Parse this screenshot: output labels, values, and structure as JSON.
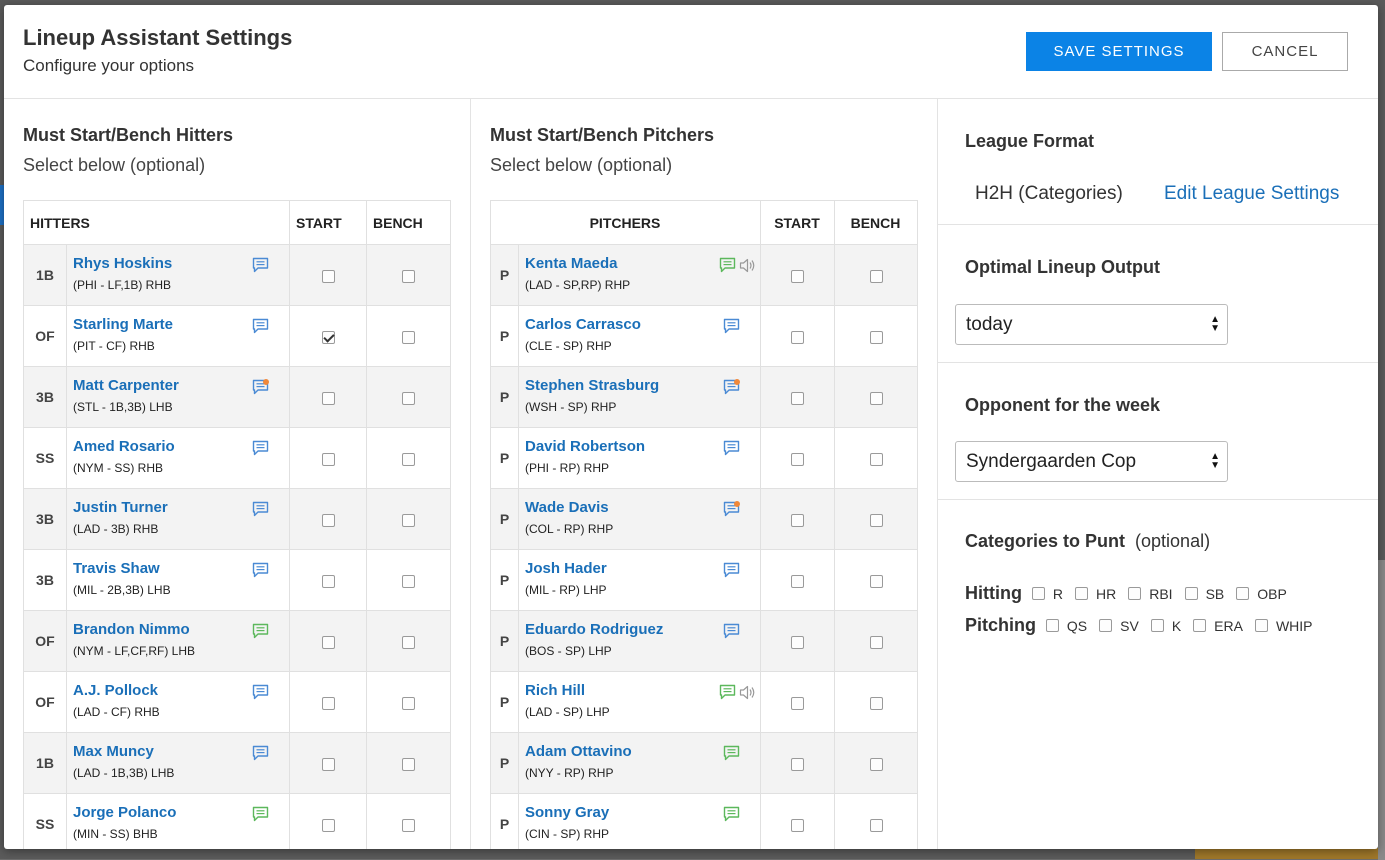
{
  "header": {
    "title": "Lineup Assistant Settings",
    "subtitle": "Configure your options",
    "save_label": "SAVE SETTINGS",
    "cancel_label": "CANCEL"
  },
  "hitters_section": {
    "title": "Must Start/Bench Hitters",
    "subtitle": "Select below (optional)",
    "columns": [
      "HITTERS",
      "START",
      "BENCH"
    ],
    "rows": [
      {
        "pos": "1B",
        "name": "Rhys Hoskins",
        "info": "(PHI - LF,1B) RHB",
        "note": "blue",
        "start": false,
        "bench": false
      },
      {
        "pos": "OF",
        "name": "Starling Marte",
        "info": "(PIT - CF) RHB",
        "note": "blue",
        "start": true,
        "bench": false
      },
      {
        "pos": "3B",
        "name": "Matt Carpenter",
        "info": "(STL - 1B,3B) LHB",
        "note": "orange",
        "start": false,
        "bench": false
      },
      {
        "pos": "SS",
        "name": "Amed Rosario",
        "info": "(NYM - SS) RHB",
        "note": "blue",
        "start": false,
        "bench": false
      },
      {
        "pos": "3B",
        "name": "Justin Turner",
        "info": "(LAD - 3B) RHB",
        "note": "blue",
        "start": false,
        "bench": false
      },
      {
        "pos": "3B",
        "name": "Travis Shaw",
        "info": "(MIL - 2B,3B) LHB",
        "note": "blue",
        "start": false,
        "bench": false
      },
      {
        "pos": "OF",
        "name": "Brandon Nimmo",
        "info": "(NYM - LF,CF,RF) LHB",
        "note": "green",
        "start": false,
        "bench": false
      },
      {
        "pos": "OF",
        "name": "A.J. Pollock",
        "info": "(LAD - CF) RHB",
        "note": "blue",
        "start": false,
        "bench": false
      },
      {
        "pos": "1B",
        "name": "Max Muncy",
        "info": "(LAD - 1B,3B) LHB",
        "note": "blue",
        "start": false,
        "bench": false
      },
      {
        "pos": "SS",
        "name": "Jorge Polanco",
        "info": "(MIN - SS) BHB",
        "note": "green",
        "start": false,
        "bench": false
      }
    ]
  },
  "pitchers_section": {
    "title": "Must Start/Bench Pitchers",
    "subtitle": "Select below (optional)",
    "columns": [
      "PITCHERS",
      "START",
      "BENCH"
    ],
    "rows": [
      {
        "pos": "P",
        "name": "Kenta Maeda",
        "info": "(LAD - SP,RP) RHP",
        "note": "green",
        "sound": true,
        "start": false,
        "bench": false
      },
      {
        "pos": "P",
        "name": "Carlos Carrasco",
        "info": "(CLE - SP) RHP",
        "note": "blue",
        "sound": false,
        "start": false,
        "bench": false
      },
      {
        "pos": "P",
        "name": "Stephen Strasburg",
        "info": "(WSH - SP) RHP",
        "note": "orange",
        "sound": false,
        "start": false,
        "bench": false
      },
      {
        "pos": "P",
        "name": "David Robertson",
        "info": "(PHI - RP) RHP",
        "note": "blue",
        "sound": false,
        "start": false,
        "bench": false
      },
      {
        "pos": "P",
        "name": "Wade Davis",
        "info": "(COL - RP) RHP",
        "note": "orange",
        "sound": false,
        "start": false,
        "bench": false
      },
      {
        "pos": "P",
        "name": "Josh Hader",
        "info": "(MIL - RP) LHP",
        "note": "blue",
        "sound": false,
        "start": false,
        "bench": false
      },
      {
        "pos": "P",
        "name": "Eduardo Rodriguez",
        "info": "(BOS - SP) LHP",
        "note": "blue",
        "sound": false,
        "start": false,
        "bench": false
      },
      {
        "pos": "P",
        "name": "Rich Hill",
        "info": "(LAD - SP) LHP",
        "note": "green",
        "sound": true,
        "start": false,
        "bench": false
      },
      {
        "pos": "P",
        "name": "Adam Ottavino",
        "info": "(NYY - RP) RHP",
        "note": "green",
        "sound": false,
        "start": false,
        "bench": false
      },
      {
        "pos": "P",
        "name": "Sonny Gray",
        "info": "(CIN - SP) RHP",
        "note": "green",
        "sound": false,
        "start": false,
        "bench": false
      }
    ]
  },
  "settings": {
    "league_format": {
      "title": "League Format",
      "value": "H2H (Categories)",
      "link": "Edit League Settings"
    },
    "optimal_output": {
      "title": "Optimal Lineup Output",
      "selected": "today"
    },
    "opponent": {
      "title": "Opponent for the week",
      "selected": "Syndergaarden Cop"
    },
    "punt": {
      "title": "Categories to Punt",
      "optional": "(optional)",
      "hitting_label": "Hitting",
      "hitting": [
        "R",
        "HR",
        "RBI",
        "SB",
        "OBP"
      ],
      "pitching_label": "Pitching",
      "pitching": [
        "QS",
        "SV",
        "K",
        "ERA",
        "WHIP"
      ]
    }
  },
  "colors": {
    "accent": "#0b83e6",
    "link": "#1a6fb8",
    "note_blue": "#4a8ad4",
    "note_green": "#5cb85c",
    "note_orange": "#f0883a"
  }
}
